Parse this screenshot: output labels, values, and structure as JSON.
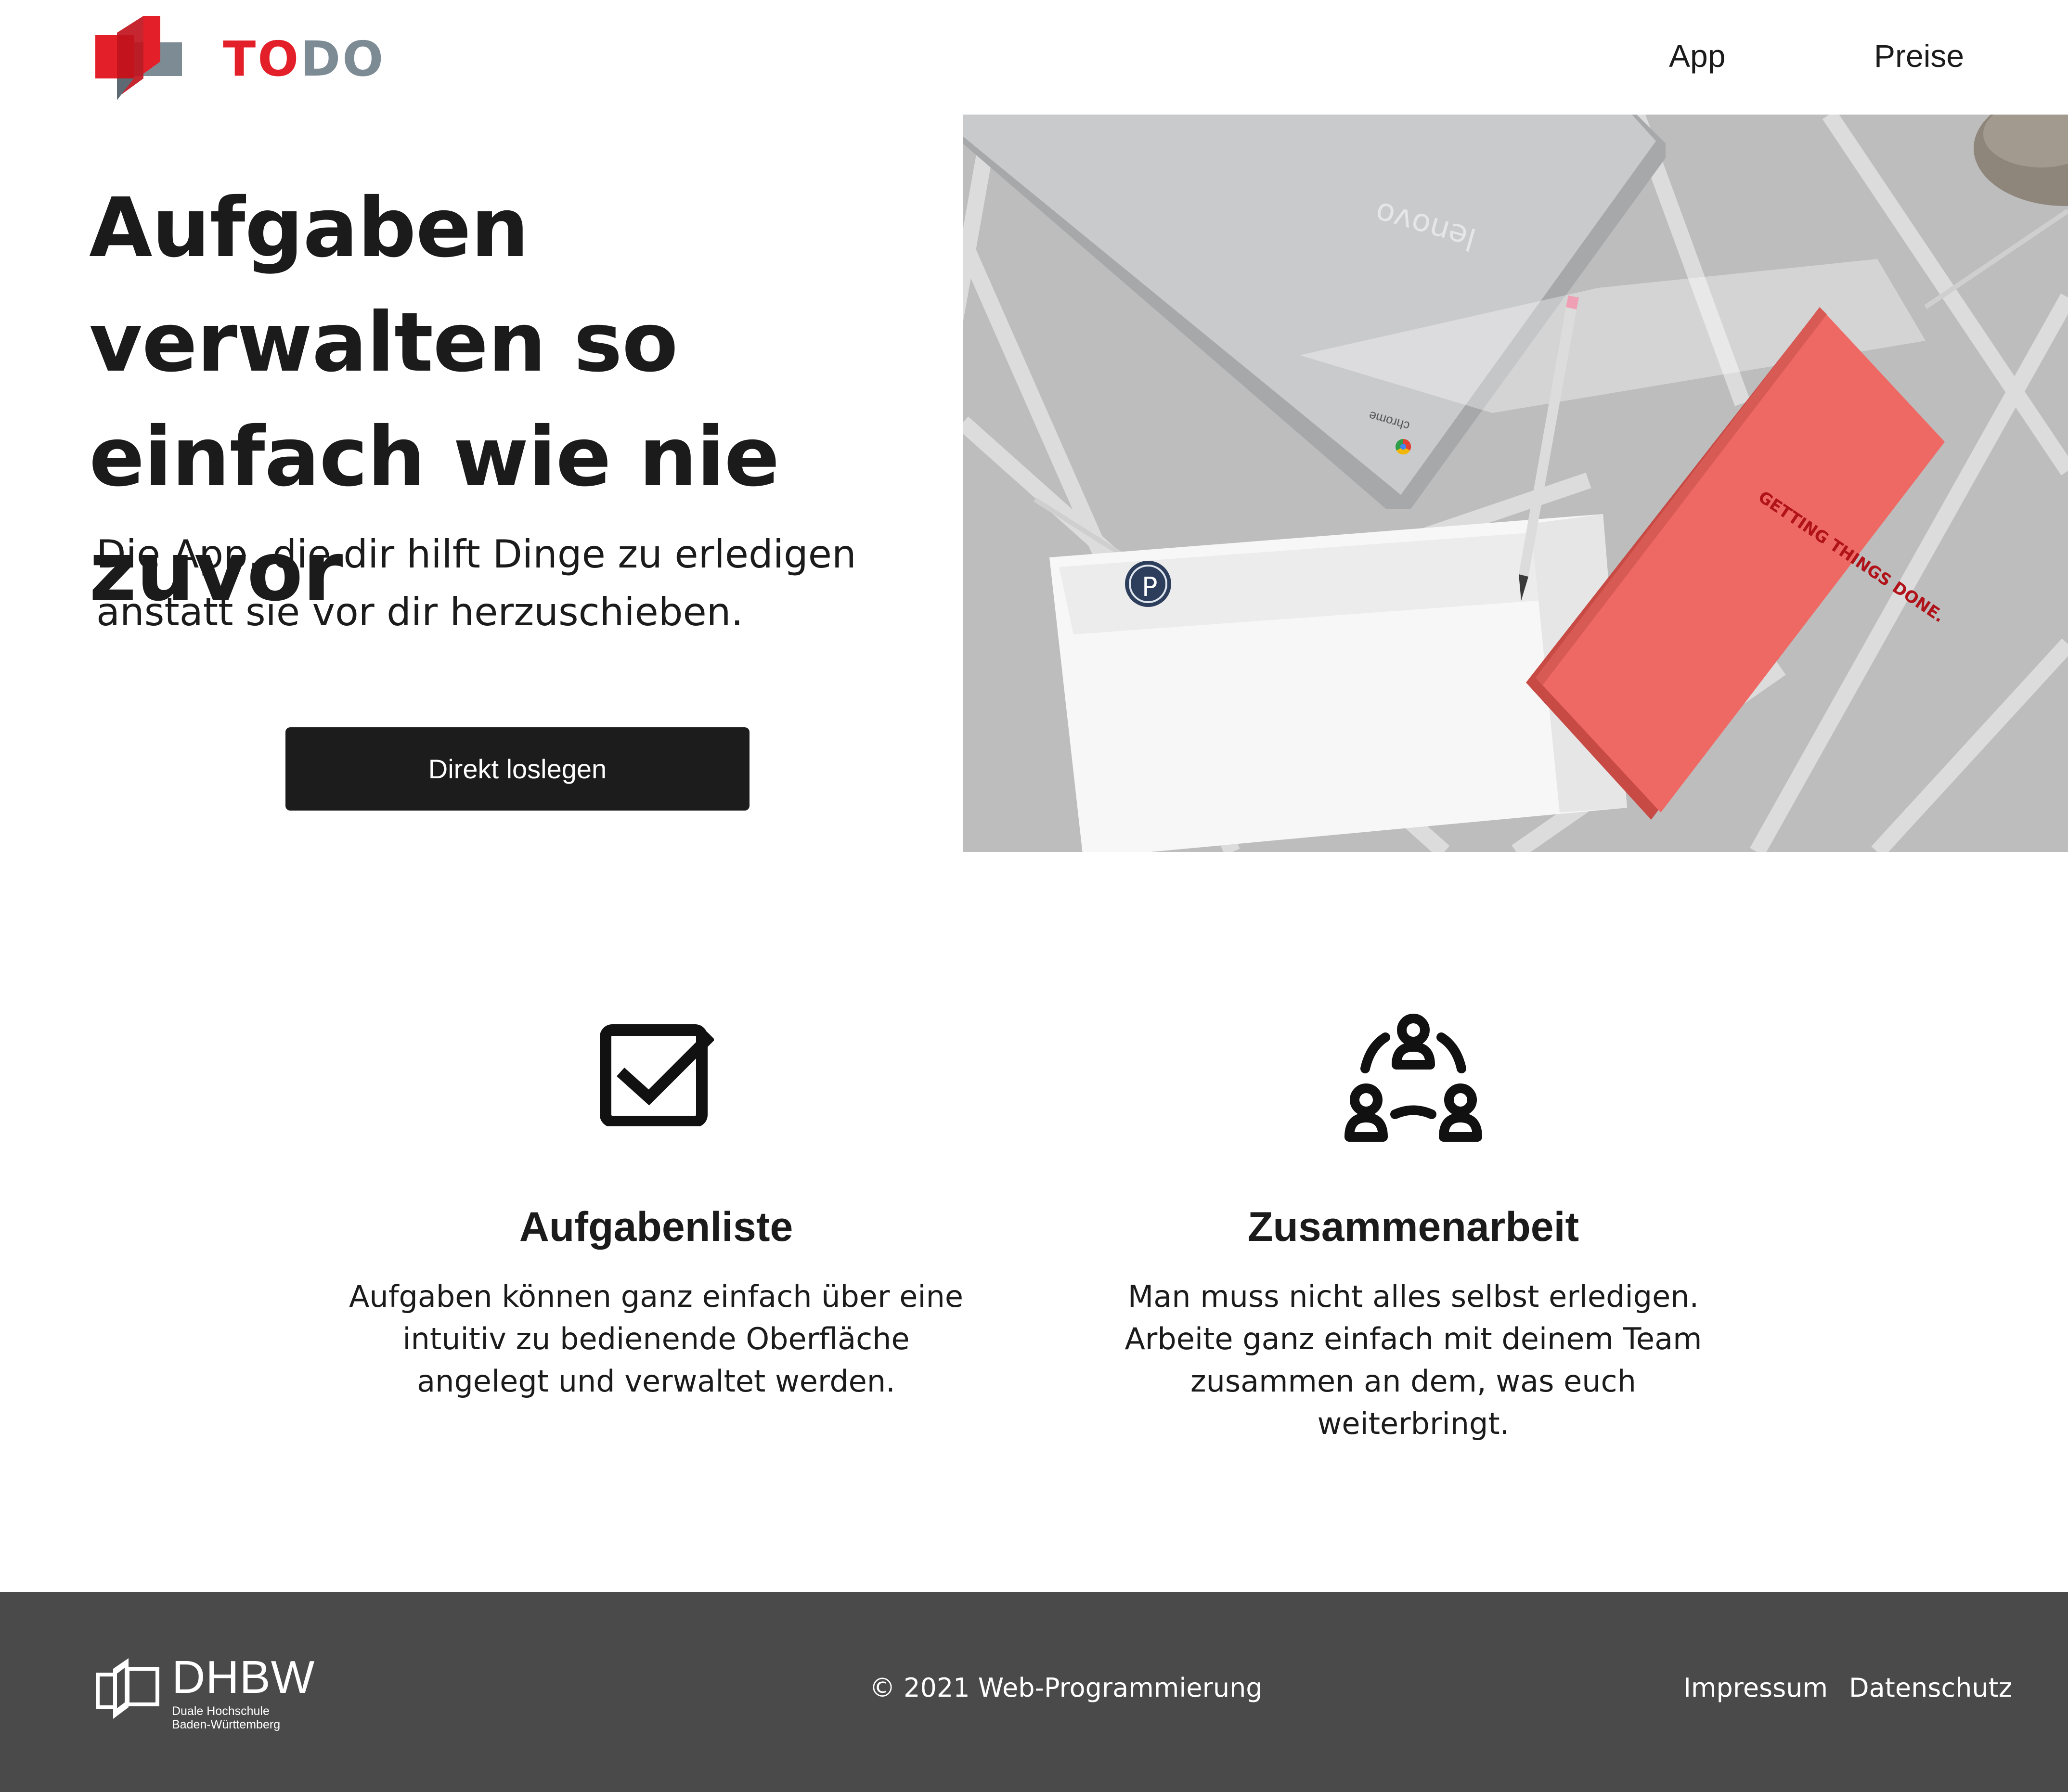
{
  "header": {
    "logo": {
      "part1": "TO",
      "part2": "DO"
    },
    "nav": [
      {
        "label": "App"
      },
      {
        "label": "Preise"
      }
    ]
  },
  "hero": {
    "title": "Aufgaben verwalten so einfach wie nie zuvor",
    "subtitle": "Die App, die dir hilft Dinge zu erledigen anstatt sie vor dir herzuschieben.",
    "cta_label": "Direkt loslegen",
    "photo": {
      "laptop_label": "chrome",
      "book_text": "GETTING THINGS DONE.",
      "sticker_letter": "P"
    }
  },
  "features": [
    {
      "icon": "checkbox-icon",
      "title": "Aufgabenliste",
      "text": "Aufgaben können ganz einfach über eine intuitiv zu bedienende Oberfläche angelegt und verwaltet werden."
    },
    {
      "icon": "team-icon",
      "title": "Zusammenarbeit",
      "text": "Man muss nicht alles selbst erledigen. Arbeite ganz einfach mit deinem Team zusammen an dem, was euch weiterbringt."
    }
  ],
  "footer": {
    "logo": {
      "name": "DHBW",
      "line1": "Duale Hochschule",
      "line2": "Baden-Württemberg"
    },
    "copyright": "© 2021 Web-Programmierung",
    "links": [
      {
        "label": "Impressum"
      },
      {
        "label": "Datenschutz"
      }
    ]
  },
  "colors": {
    "brand_red": "#e3202a",
    "brand_gray": "#7d8b95",
    "button_bg": "#1c1c1c",
    "footer_bg": "#4a4a4a",
    "book_coral": "#ef6964"
  }
}
